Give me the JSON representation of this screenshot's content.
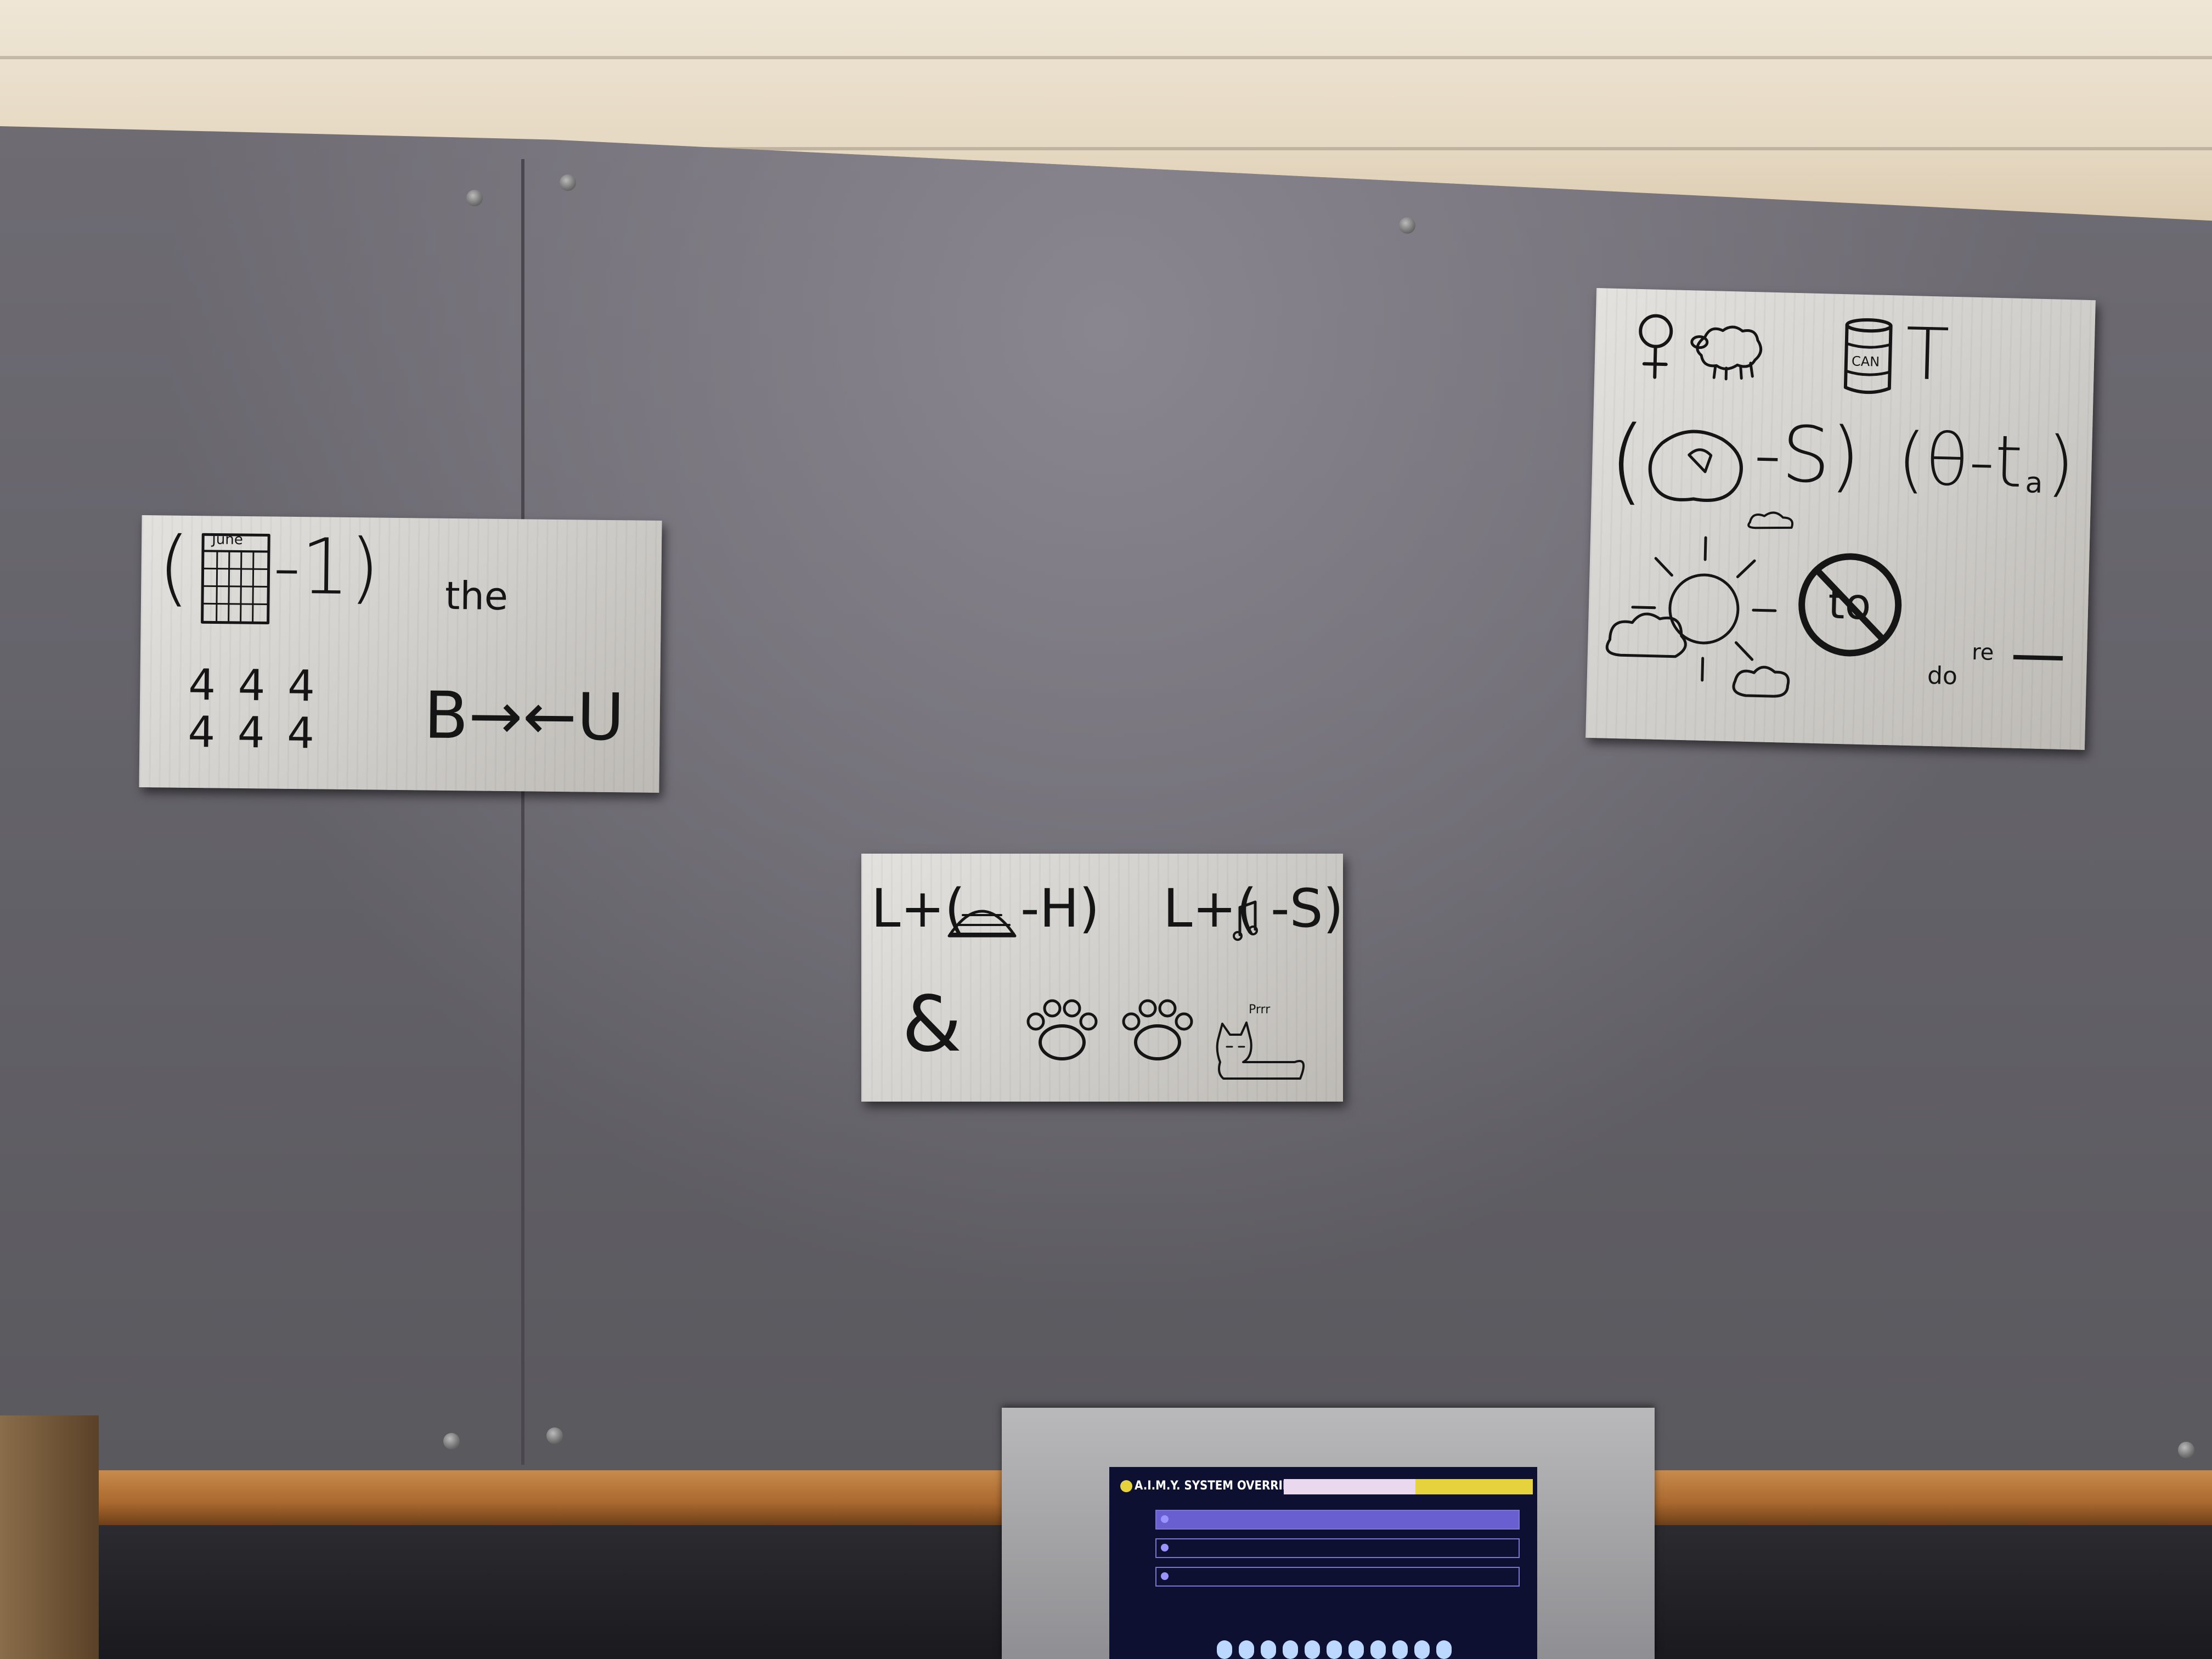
{
  "scene": "wall-with-puzzle-signs",
  "sign1": {
    "calendar_month": "June",
    "paren_open": "(",
    "minus_one": "-1)",
    "word_the": "the",
    "digits_row1": "4 4 4",
    "digits_row2": "4 4 4",
    "b_arrows_u": "B→←U"
  },
  "sign2": {
    "l_plus_open_1": "L+(",
    "minus_h": "-H)",
    "l_plus_open_2": "L+(",
    "minus_s": "-S)",
    "ampersand": "&",
    "cat_sound": "Prrr"
  },
  "sign3": {
    "letter_t": "T",
    "can_label": "CAN",
    "paren_open": "(",
    "minus_s": "-S)",
    "theta_minus": "(θ-t",
    "subscript_a": "a",
    "paren_close": ")",
    "no_symbol_text": "to",
    "do": "do",
    "re": "re"
  },
  "terminal": {
    "title": "A.I.M.Y. SYSTEM OVERRIDE",
    "accent_color": "#e6d23c",
    "bar_color": "#6a5fd0"
  }
}
